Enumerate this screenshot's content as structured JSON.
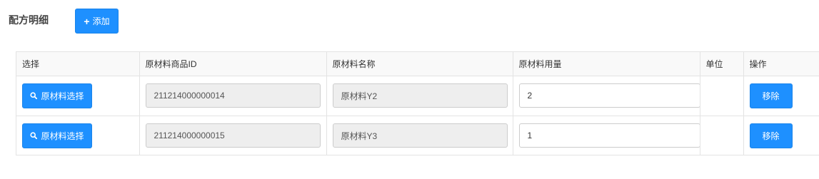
{
  "section": {
    "title": "配方明细",
    "add_label": "添加"
  },
  "table": {
    "headers": [
      "选择",
      "原材料商品ID",
      "原材料名称",
      "原材料用量",
      "单位",
      "操作"
    ],
    "select_button_label": "原材料选择",
    "remove_button_label": "移除",
    "rows": [
      {
        "id": "211214000000014",
        "name": "原材料Y2",
        "quantity": "2",
        "unit": ""
      },
      {
        "id": "211214000000015",
        "name": "原材料Y3",
        "quantity": "1",
        "unit": ""
      }
    ]
  },
  "colors": {
    "primary": "#1e90ff",
    "header_bg": "#f9f9f9",
    "readonly_bg": "#eeeeee",
    "border": "#e3e3e3"
  },
  "icons": {
    "add": "plus-icon",
    "select": "search-icon"
  }
}
